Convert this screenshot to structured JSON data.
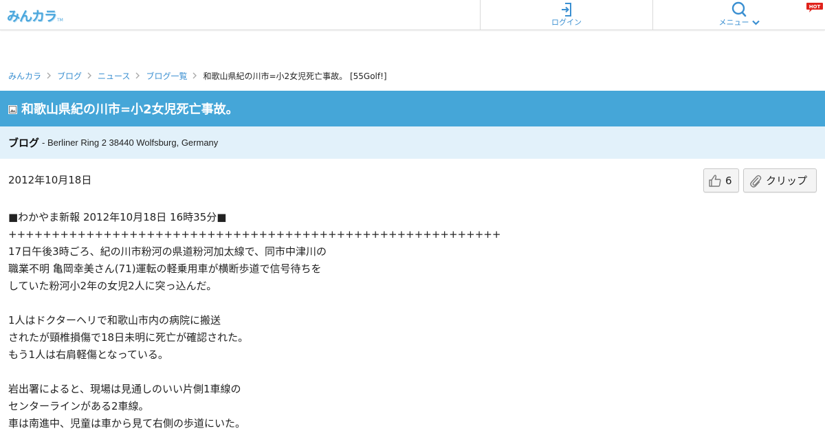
{
  "header": {
    "logo_text": "みんカラ",
    "logo_tm": "TM",
    "login_label": "ログイン",
    "menu_label": "メニュー",
    "hot_badge": "HOT",
    "colors": {
      "accent": "#3a8fd1",
      "hot": "#e0221b"
    }
  },
  "breadcrumb": {
    "items": [
      "みんカラ",
      "ブログ",
      "ニュース",
      "ブログ一覧"
    ],
    "current": "和歌山県紀の川市=小2女児死亡事故。 [55Golf!]"
  },
  "post": {
    "title": "和歌山県紀の川市=小2女児死亡事故。",
    "category": "ブログ",
    "location": "- Berliner Ring 2 38440 Wolfsburg, Germany",
    "date": "2012年10月18日",
    "like_count": "6",
    "clip_label": "クリップ",
    "body_lines": [
      "■わかやま新報 2012年10月18日 16時35分■",
      "+++++++++++++++++++++++++++++++++++++++++++++++++++++++++",
      "17日午後3時ごろ、紀の川市粉河の県道粉河加太線で、同市中津川の",
      "職業不明 亀岡幸美さん(71)運転の軽乗用車が横断歩道で信号待ちを",
      "していた粉河小2年の女児2人に突っ込んだ。",
      "",
      "1人はドクターヘリで和歌山市内の病院に搬送",
      "されたが頸椎損傷で18日未明に死亡が確認された。",
      "もう1人は右肩軽傷となっている。",
      "",
      "岩出署によると、現場は見通しのいい片側1車線の",
      "センターラインがある2車線。",
      "車は南進中、児童は車から見て右側の歩道にいた。"
    ]
  },
  "icons": {
    "login": "login-icon",
    "menu": "search-icon",
    "menu_chevron": "chevron-down-icon",
    "like": "thumbs-up-icon",
    "clip": "paperclip-icon",
    "title": "image-icon",
    "crumb": "chevron-right-icon"
  },
  "colors": {
    "title_bar": "#45a6d8",
    "sub_bar": "#e2f1fa",
    "link": "#3a8fd1"
  }
}
